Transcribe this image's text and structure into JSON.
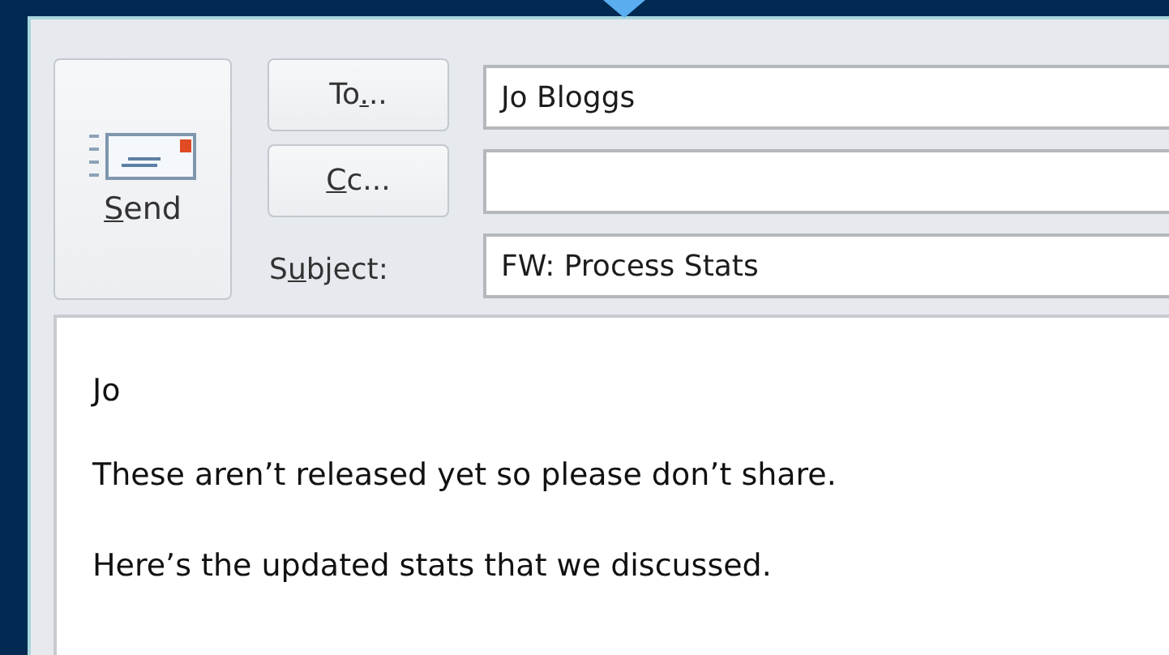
{
  "send_button": {
    "label": {
      "key": "S",
      "after": "end"
    }
  },
  "address_buttons": [
    {
      "label": {
        "before": "To",
        "key": ".",
        "after": ".."
      }
    },
    {
      "label": {
        "key": "C",
        "after": "c..."
      }
    }
  ],
  "subject_label": {
    "before": "S",
    "key": "u",
    "after": "bject:"
  },
  "to_field": {
    "value": "Jo Bloggs"
  },
  "subject_field": {
    "value": "FW: Process Stats"
  },
  "body": [
    "Jo",
    "These aren’t released yet so please don’t share.",
    "Here’s the updated stats that we discussed."
  ]
}
